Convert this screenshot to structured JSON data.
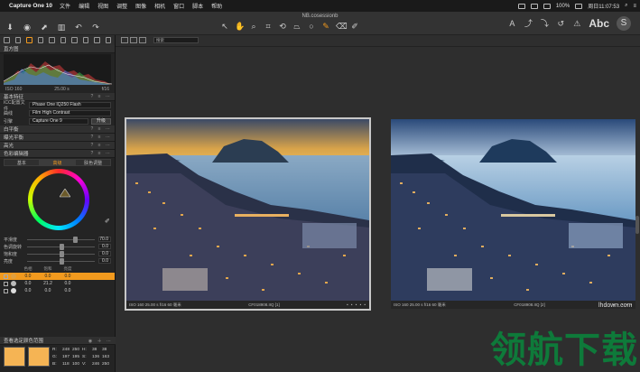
{
  "menubar": {
    "app_name": "Capture One 10",
    "items": [
      "文件",
      "编辑",
      "视图",
      "调整",
      "图像",
      "相机",
      "窗口",
      "脚本",
      "帮助"
    ],
    "battery": "100%",
    "clock": "周日11:07:53"
  },
  "toolbar": {
    "document_title": "NB.cosessionb",
    "text_tool": "Abc"
  },
  "left_panel": {
    "histogram_title": "直方图",
    "histogram_info": [
      "ISO 160",
      "25.00 s",
      "f/16"
    ],
    "base_section_title": "基本特征",
    "icc_label": "ICC配置文件",
    "icc_value": "Phase One IQ250 Flash",
    "curve_label": "曲线",
    "curve_value": "Film High Contrast",
    "engine_label": "引擎",
    "engine_value": "Capture One 9",
    "engine_button": "升级",
    "section_white_balance": "白平衡",
    "section_exposure": "曝光平衡",
    "section_highlight": "高光",
    "section_color_editor": "色彩编辑器",
    "subtabs": [
      "基本",
      "高级",
      "肤色调整"
    ],
    "active_subtab": 1,
    "sliders": [
      {
        "label": "平滑度",
        "value": "70.0",
        "pos": 0.7
      },
      {
        "label": "色调旋转",
        "value": "0.0",
        "pos": 0.5
      },
      {
        "label": "饱和度",
        "value": "0.0",
        "pos": 0.5
      },
      {
        "label": "亮度",
        "value": "0.0",
        "pos": 0.5
      }
    ],
    "table_headers": [
      "色相",
      "饱和",
      "亮度"
    ],
    "table_rows": [
      {
        "values": [
          "0.0",
          "0.0",
          "0.0"
        ],
        "color": "#e0a040",
        "selected": true
      },
      {
        "values": [
          "0.0",
          "21.2",
          "0.0"
        ],
        "color": "#bbbbbb",
        "selected": false
      },
      {
        "values": [
          "0.0",
          "0.0",
          "0.0"
        ],
        "color": "#dddddd",
        "selected": false
      }
    ],
    "bottom_section_title": "查看选定颜色范围",
    "swatch_color": "#f5b454",
    "rgb_readout": [
      [
        "R:",
        "248",
        "250",
        "H:",
        "38",
        "38"
      ],
      [
        "G:",
        "197",
        "195",
        "S:",
        "136",
        "163"
      ],
      [
        "B:",
        "118",
        "100",
        "V:",
        "246",
        "250"
      ]
    ]
  },
  "viewer": {
    "search_placeholder": "搜索",
    "images": [
      {
        "caption_left": "ISO 160   25.00 s   f/16   60 毫米",
        "caption_center": "CF018908.IIQ [1]",
        "selected": true
      },
      {
        "caption_left": "ISO 160   25.00 s   f/16   60 毫米",
        "caption_center": "CF018908.IIQ [2]",
        "selected": false
      }
    ],
    "rating_stars": "• • • • •"
  },
  "watermark": {
    "url": "lhdown.com",
    "text": "领航下载"
  },
  "colors": {
    "accent": "#f29a1e",
    "panel": "#242424",
    "viewer_bg": "#2e2e2e"
  }
}
